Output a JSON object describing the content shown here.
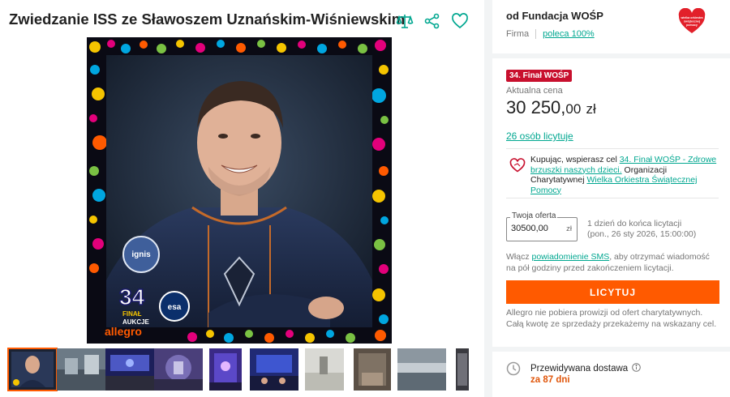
{
  "listing": {
    "title": "Zwiedzanie ISS ze Sławoszem Uznańskim-Wiśniewskim"
  },
  "icons": {
    "compare": "scales-icon",
    "share": "share-icon",
    "favorite": "heart-outline-icon",
    "charity": "heart-outline-icon",
    "delivery": "clock-icon",
    "info": "info-icon"
  },
  "seller": {
    "name": "od Fundacja WOŚP",
    "type": "Firma",
    "recommend": "poleca 100%",
    "logo_text": [
      "wielka orkiestra",
      "świątecznej",
      "pomocy"
    ]
  },
  "image_overlay": {
    "badge_number": "34",
    "badge_line1": "FINAŁ",
    "badge_line2": "AUKCJE",
    "badge_brand": "allegro",
    "patch_left": "ignis",
    "patch_right": "esa"
  },
  "offer": {
    "badge": "34. Finał WOŚP",
    "price_label": "Aktualna cena",
    "price_main": "30 250,",
    "price_cents": "00",
    "price_currency": "zł",
    "bidders": "26 osób licytuje",
    "charity_text_1": "Kupując, wspierasz cel ",
    "charity_link_1": "34. Finał WOŚP - Zdrowe brzuszki naszych dzieci.",
    "charity_text_2": " Organizacji Charytatywnej ",
    "charity_link_2": "Wielka Orkiestra Świątecznej Pomocy",
    "bid_label": "Twoja oferta",
    "bid_value": "30500,00",
    "bid_currency": "zł",
    "time_left": "1 dzień do końca licytacji",
    "end_date": "(pon., 26 sty 2026, 15:00:00)",
    "sms_text_1": "Włącz ",
    "sms_link": "powiadomienie SMS",
    "sms_text_2": ", aby otrzymać wiadomość na pół godziny przed zakończeniem licytacji.",
    "bid_button": "LICYTUJ",
    "no_fee_note": "Allegro nie pobiera prowizji od ofert charytatywnych. Całą kwotę ze sprzedaży przekażemy na wskazany cel."
  },
  "delivery": {
    "label": "Przewidywana dostawa",
    "value": "za 87 dni"
  },
  "colors": {
    "accent_orange": "#ff5a00",
    "link_teal": "#00a790",
    "wosp_red": "#c8102e",
    "delivery_orange": "#e0560b"
  }
}
